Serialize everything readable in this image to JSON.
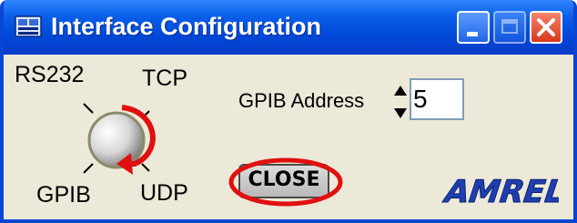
{
  "window": {
    "title": "Interface Configuration"
  },
  "titlebar_buttons": {
    "minimize": "minimize",
    "maximize": "maximize",
    "close": "close"
  },
  "interface_selector": {
    "options": {
      "top_left": "RS232",
      "top_right": "TCP",
      "bottom_left": "GPIB",
      "bottom_right": "UDP"
    },
    "selected": "GPIB"
  },
  "gpib": {
    "label": "GPIB Address",
    "value": "5"
  },
  "close_button": {
    "label": "CLOSE"
  },
  "logo": {
    "text": "AMREL"
  },
  "colors": {
    "titlebar": "#0a5fe8",
    "window_bg": "#ece9d8",
    "annotation_red": "#e01010",
    "logo_blue": "#1f3fb0"
  }
}
